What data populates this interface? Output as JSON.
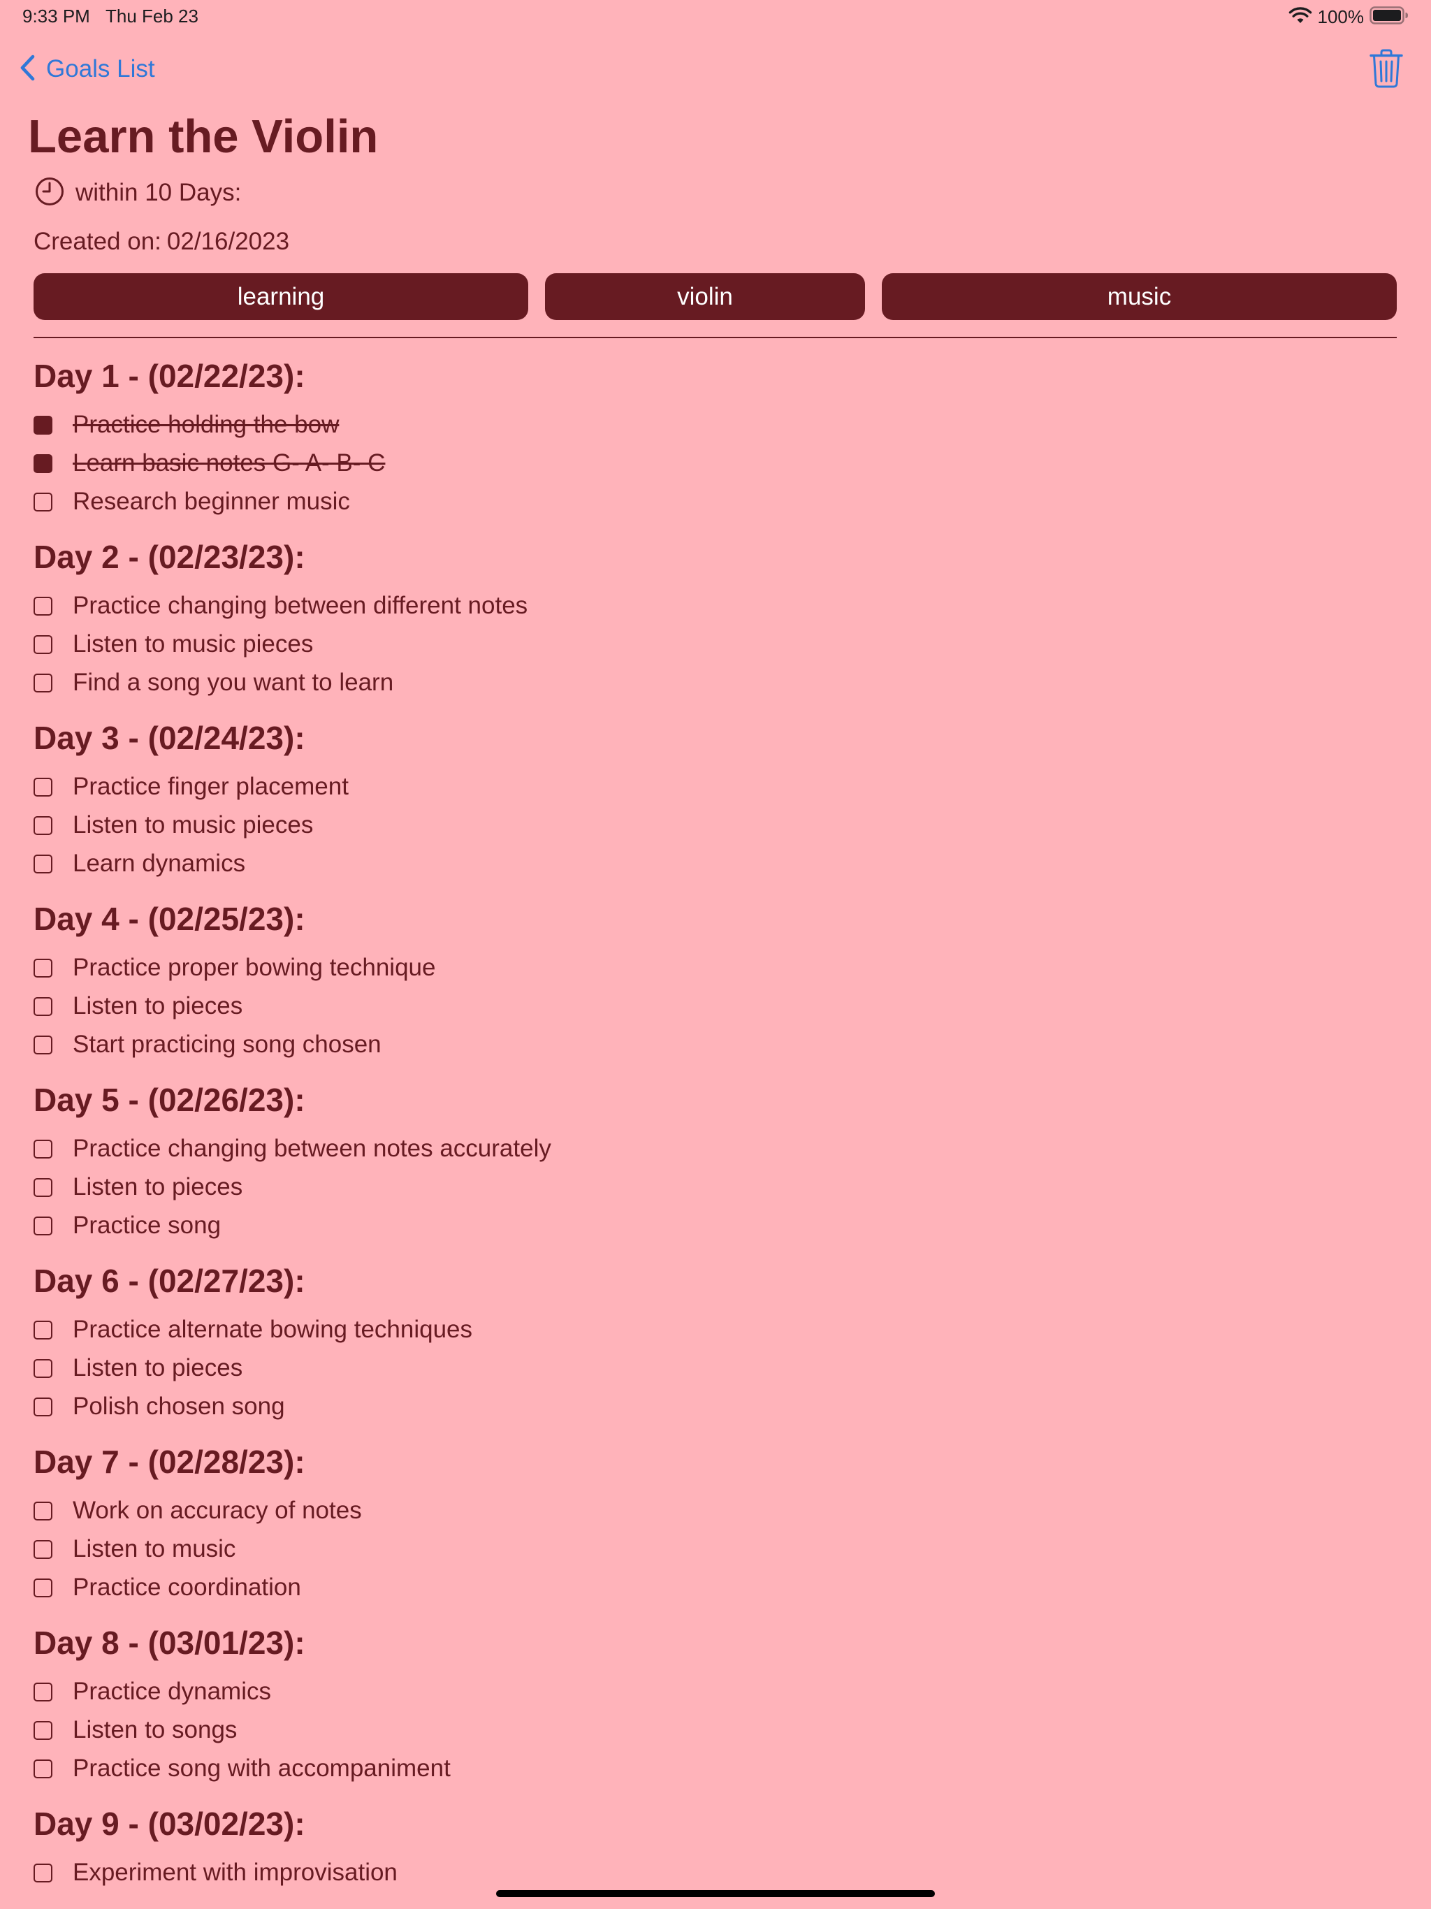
{
  "status_bar": {
    "time": "9:33 PM",
    "date": "Thu Feb 23",
    "battery": "100%"
  },
  "nav": {
    "back_label": "Goals List",
    "trash_icon": "trash-icon"
  },
  "goal": {
    "title": "Learn the Violin",
    "deadline": "within 10 Days:",
    "created_label": "Created on:",
    "created_date": "02/16/2023"
  },
  "tags": [
    "learning",
    "violin",
    "music"
  ],
  "colors": {
    "background": "#ffb3ba",
    "accent": "#671b22",
    "link": "#2f78d8"
  },
  "days": [
    {
      "heading": "Day 1 - (02/22/23):",
      "tasks": [
        {
          "label": "Practice holding the bow",
          "done": true
        },
        {
          "label": "Learn basic notes G- A- B- C",
          "done": true
        },
        {
          "label": "Research beginner music",
          "done": false
        }
      ]
    },
    {
      "heading": "Day 2 - (02/23/23):",
      "tasks": [
        {
          "label": "Practice changing between different notes",
          "done": false
        },
        {
          "label": "Listen to music pieces",
          "done": false
        },
        {
          "label": "Find a song you want to learn",
          "done": false
        }
      ]
    },
    {
      "heading": "Day 3 - (02/24/23):",
      "tasks": [
        {
          "label": "Practice finger placement",
          "done": false
        },
        {
          "label": "Listen to music pieces",
          "done": false
        },
        {
          "label": "Learn dynamics",
          "done": false
        }
      ]
    },
    {
      "heading": "Day 4 - (02/25/23):",
      "tasks": [
        {
          "label": "Practice proper bowing technique",
          "done": false
        },
        {
          "label": "Listen to pieces",
          "done": false
        },
        {
          "label": "Start practicing song chosen",
          "done": false
        }
      ]
    },
    {
      "heading": "Day 5 - (02/26/23):",
      "tasks": [
        {
          "label": "Practice changing between notes accurately",
          "done": false
        },
        {
          "label": "Listen to pieces",
          "done": false
        },
        {
          "label": "Practice song",
          "done": false
        }
      ]
    },
    {
      "heading": "Day 6 - (02/27/23):",
      "tasks": [
        {
          "label": "Practice alternate bowing techniques",
          "done": false
        },
        {
          "label": "Listen to pieces",
          "done": false
        },
        {
          "label": "Polish chosen song",
          "done": false
        }
      ]
    },
    {
      "heading": "Day 7 - (02/28/23):",
      "tasks": [
        {
          "label": "Work on accuracy of notes",
          "done": false
        },
        {
          "label": "Listen to music",
          "done": false
        },
        {
          "label": "Practice coordination",
          "done": false
        }
      ]
    },
    {
      "heading": "Day 8 - (03/01/23):",
      "tasks": [
        {
          "label": "Practice dynamics",
          "done": false
        },
        {
          "label": "Listen to songs",
          "done": false
        },
        {
          "label": "Practice song with accompaniment",
          "done": false
        }
      ]
    },
    {
      "heading": "Day 9 - (03/02/23):",
      "tasks": [
        {
          "label": "Experiment with improvisation",
          "done": false
        }
      ]
    }
  ]
}
